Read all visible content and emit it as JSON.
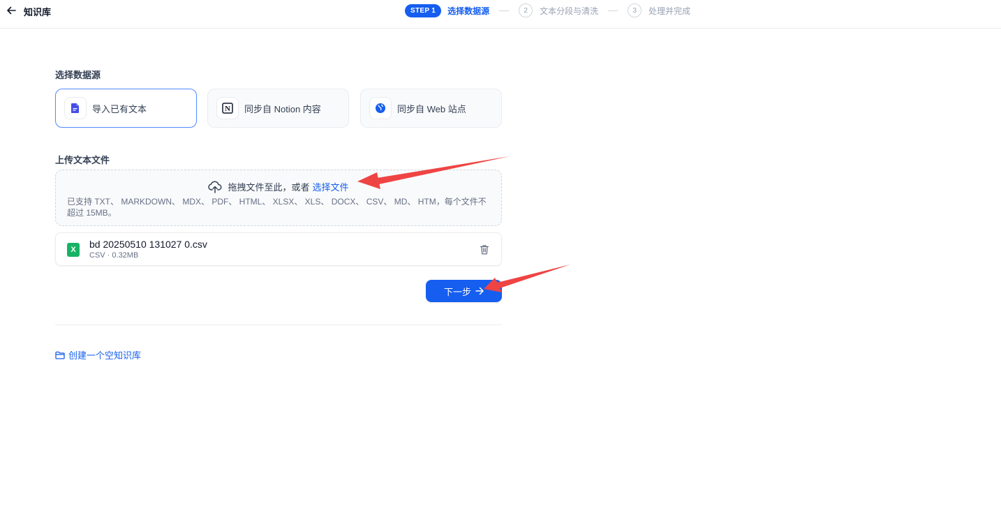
{
  "header": {
    "back_icon": "arrow-left-icon",
    "title": "知识库",
    "steps": {
      "active_badge": "STEP 1",
      "active_label": "选择数据源",
      "step2_number": "2",
      "step2_label": "文本分段与清洗",
      "step3_number": "3",
      "step3_label": "处理并完成"
    }
  },
  "data_source": {
    "title": "选择数据源",
    "options": [
      {
        "label": "导入已有文本",
        "icon": "file-text-icon",
        "selected": true
      },
      {
        "label": "同步自 Notion 内容",
        "icon": "notion-icon",
        "selected": false
      },
      {
        "label": "同步自 Web 站点",
        "icon": "globe-icon",
        "selected": false
      }
    ]
  },
  "upload": {
    "title": "上传文本文件",
    "drag_text": "拖拽文件至此，或者",
    "select_link": "选择文件",
    "tip": "已支持 TXT、 MARKDOWN、 MDX、 PDF、 HTML、 XLSX、 XLS、 DOCX、 CSV、 MD、 HTM，每个文件不超过 15MB。"
  },
  "file": {
    "icon_letter": "X",
    "name": "bd 20250510 131027 0.csv",
    "meta": "CSV · 0.32MB"
  },
  "next_button": {
    "label": "下一步"
  },
  "empty_kb_link": {
    "label": "创建一个空知识库"
  },
  "colors": {
    "primary": "#155eef",
    "annotation_arrow": "#ef4444",
    "csv_icon": "#16b364"
  }
}
